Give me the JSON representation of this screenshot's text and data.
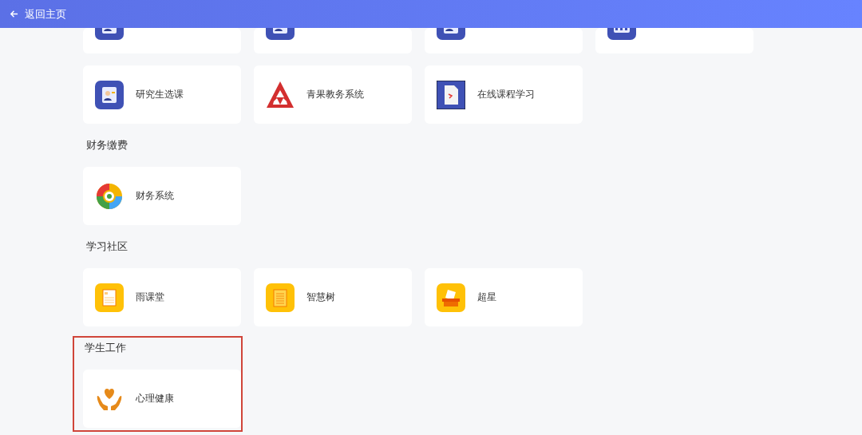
{
  "header": {
    "back_label": "返回主页"
  },
  "sections": [
    {
      "highlighted": false,
      "items": [
        {
          "kind": "person-card"
        },
        {
          "kind": "person-card"
        },
        {
          "kind": "person-card"
        },
        {
          "kind": "grid-card"
        },
        {
          "kind": "person-card",
          "label": "研究生选课"
        },
        {
          "kind": "triangle",
          "label": "青果教务系统"
        },
        {
          "kind": "document",
          "label": "在线课程学习"
        }
      ]
    },
    {
      "title": "财务缴费",
      "highlighted": false,
      "items": [
        {
          "kind": "swirl",
          "label": "财务系统"
        }
      ]
    },
    {
      "title": "学习社区",
      "highlighted": false,
      "items": [
        {
          "kind": "note",
          "label": "雨课堂"
        },
        {
          "kind": "notepad",
          "label": "智慧树"
        },
        {
          "kind": "box",
          "label": "超星"
        }
      ]
    },
    {
      "title": "学生工作",
      "highlighted": true,
      "items": [
        {
          "kind": "heart-hands",
          "label": "心理健康"
        }
      ]
    }
  ]
}
